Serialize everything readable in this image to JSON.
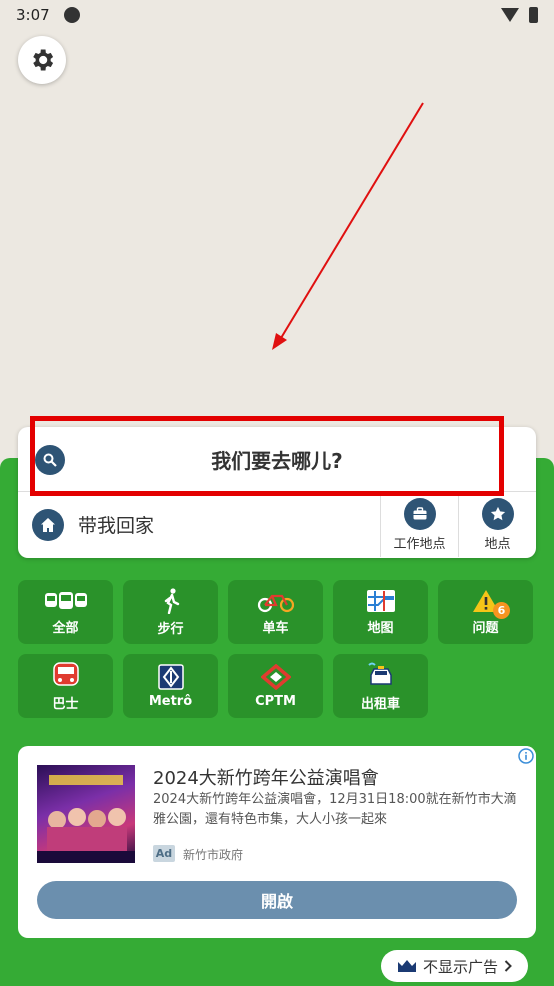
{
  "status_bar": {
    "time": "3:07"
  },
  "search": {
    "placeholder": "我们要去哪儿?"
  },
  "home": {
    "label": "带我回家"
  },
  "shortcuts": [
    {
      "label": "工作地点",
      "icon": "briefcase-icon"
    },
    {
      "label": "地点",
      "icon": "star-icon"
    }
  ],
  "modes": [
    {
      "label": "全部",
      "icon": "transit-all-icon"
    },
    {
      "label": "步行",
      "icon": "walk-icon"
    },
    {
      "label": "单车",
      "icon": "bike-icon"
    },
    {
      "label": "地图",
      "icon": "map-icon"
    },
    {
      "label": "问题",
      "icon": "warning-icon",
      "badge": "6"
    },
    {
      "label": "巴士",
      "icon": "bus-icon"
    },
    {
      "label": "Metrô",
      "icon": "metro-icon"
    },
    {
      "label": "CPTM",
      "icon": "cptm-icon"
    },
    {
      "label": "出租車",
      "icon": "taxi-icon"
    }
  ],
  "ad": {
    "title": "2024大新竹跨年公益演唱會",
    "body": "2024大新竹跨年公益演唱會，12月31日18:00就在新竹市大滴雅公園，還有特色市集，大人小孩一起來",
    "tag": "Ad",
    "advertiser": "新竹市政府",
    "button": "開啟"
  },
  "remove_ads": {
    "label": "不显示广告"
  },
  "colors": {
    "green": "#35ab35",
    "tile": "#2a922a",
    "navy": "#2e5475",
    "highlight": "#e30000"
  }
}
